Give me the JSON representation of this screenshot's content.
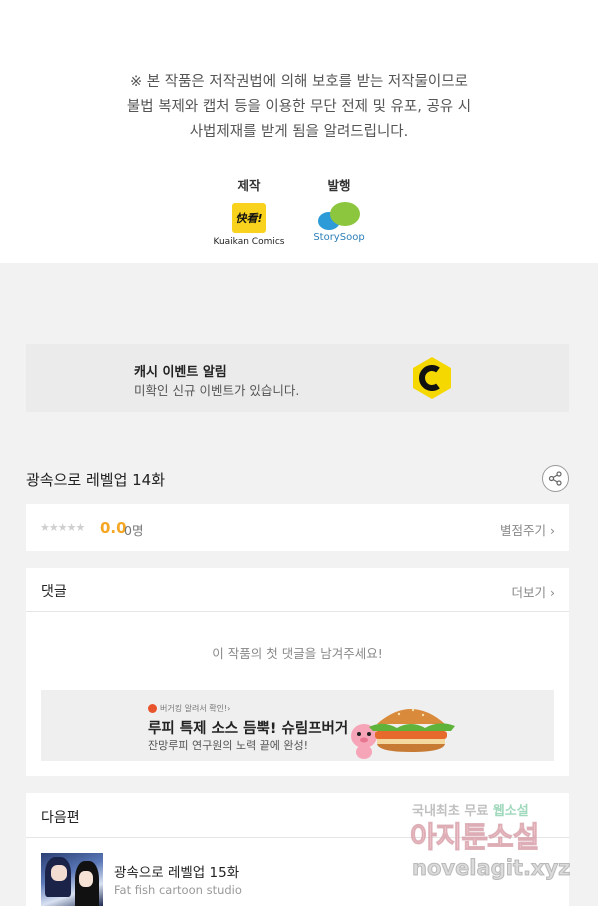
{
  "notice": {
    "line1": "※ 본 작품은 저작권법에 의해 보호를 받는 저작물이므로",
    "line2": "불법 복제와 캡처 등을  이용한 무단 전제 및 유포, 공유 시",
    "line3": "사법제재를  받게 됨을 알려드립니다."
  },
  "credits": {
    "production_label": "제작",
    "production_logo_text": "快看!",
    "production_name": "Kuaikan Comics",
    "publisher_label": "발행",
    "publisher_name": "StorySoop"
  },
  "event": {
    "title": "캐시 이벤트 알림",
    "desc": "미확인 신규 이벤트가 있습니다.",
    "icon": "cash-c-hexagon-icon",
    "icon_color": "#f5d800"
  },
  "episode": {
    "title": "광속으로 레벨업 14화"
  },
  "rating": {
    "stars": "★★★★★",
    "score": "0.0",
    "count": "0명",
    "rate_button": "별점주기 ›"
  },
  "comments": {
    "label": "댓글",
    "more": "더보기 ›",
    "empty": "이 작품의 첫 댓글을 남겨주세요!"
  },
  "ad": {
    "tag": "버거킹 알려서 확인!›",
    "title": "루피 특제 소스 듬뿍! 슈림프버거",
    "subtitle": "잔망루피 연구원의 노력 끝에 완성!"
  },
  "next": {
    "label": "다음편",
    "title": "광속으로 레벨업 15화",
    "author": "Fat fish cartoon studio"
  },
  "watermark": {
    "line1_a": "국내최초 무료 ",
    "line1_b": "웹소설",
    "line2": "아지툰소설",
    "line3": "novelagit.xyz"
  },
  "colors": {
    "accent_score": "#f5a623",
    "background": "#f2f2f2"
  }
}
